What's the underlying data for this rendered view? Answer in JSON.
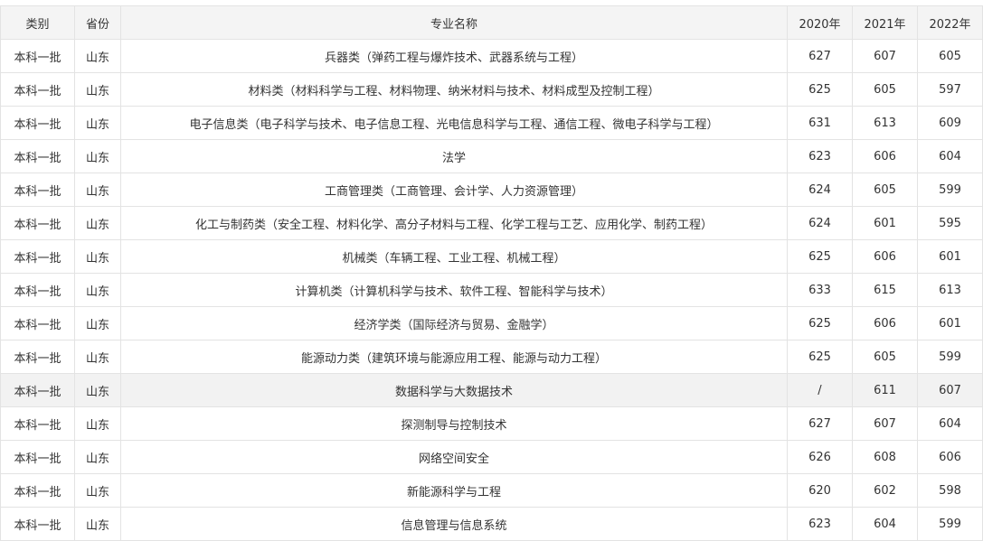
{
  "headers": {
    "type": "类别",
    "province": "省份",
    "major": "专业名称",
    "y2020": "2020年",
    "y2021": "2021年",
    "y2022": "2022年"
  },
  "rows": [
    {
      "type": "本科一批",
      "province": "山东",
      "major": "兵器类（弹药工程与爆炸技术、武器系统与工程）",
      "y2020": "627",
      "y2021": "607",
      "y2022": "605"
    },
    {
      "type": "本科一批",
      "province": "山东",
      "major": "材料类（材料科学与工程、材料物理、纳米材料与技术、材料成型及控制工程）",
      "y2020": "625",
      "y2021": "605",
      "y2022": "597"
    },
    {
      "type": "本科一批",
      "province": "山东",
      "major": "电子信息类（电子科学与技术、电子信息工程、光电信息科学与工程、通信工程、微电子科学与工程）",
      "y2020": "631",
      "y2021": "613",
      "y2022": "609"
    },
    {
      "type": "本科一批",
      "province": "山东",
      "major": "法学",
      "y2020": "623",
      "y2021": "606",
      "y2022": "604"
    },
    {
      "type": "本科一批",
      "province": "山东",
      "major": "工商管理类（工商管理、会计学、人力资源管理）",
      "y2020": "624",
      "y2021": "605",
      "y2022": "599"
    },
    {
      "type": "本科一批",
      "province": "山东",
      "major": "化工与制药类（安全工程、材料化学、高分子材料与工程、化学工程与工艺、应用化学、制药工程）",
      "y2020": "624",
      "y2021": "601",
      "y2022": "595"
    },
    {
      "type": "本科一批",
      "province": "山东",
      "major": "机械类（车辆工程、工业工程、机械工程）",
      "y2020": "625",
      "y2021": "606",
      "y2022": "601"
    },
    {
      "type": "本科一批",
      "province": "山东",
      "major": "计算机类（计算机科学与技术、软件工程、智能科学与技术）",
      "y2020": "633",
      "y2021": "615",
      "y2022": "613"
    },
    {
      "type": "本科一批",
      "province": "山东",
      "major": "经济学类（国际经济与贸易、金融学）",
      "y2020": "625",
      "y2021": "606",
      "y2022": "601"
    },
    {
      "type": "本科一批",
      "province": "山东",
      "major": "能源动力类（建筑环境与能源应用工程、能源与动力工程）",
      "y2020": "625",
      "y2021": "605",
      "y2022": "599"
    },
    {
      "type": "本科一批",
      "province": "山东",
      "major": "数据科学与大数据技术",
      "y2020": "/",
      "y2021": "611",
      "y2022": "607"
    },
    {
      "type": "本科一批",
      "province": "山东",
      "major": "探测制导与控制技术",
      "y2020": "627",
      "y2021": "607",
      "y2022": "604"
    },
    {
      "type": "本科一批",
      "province": "山东",
      "major": "网络空间安全",
      "y2020": "626",
      "y2021": "608",
      "y2022": "606"
    },
    {
      "type": "本科一批",
      "province": "山东",
      "major": "新能源科学与工程",
      "y2020": "620",
      "y2021": "602",
      "y2022": "598"
    },
    {
      "type": "本科一批",
      "province": "山东",
      "major": "信息管理与信息系统",
      "y2020": "623",
      "y2021": "604",
      "y2022": "599"
    }
  ]
}
